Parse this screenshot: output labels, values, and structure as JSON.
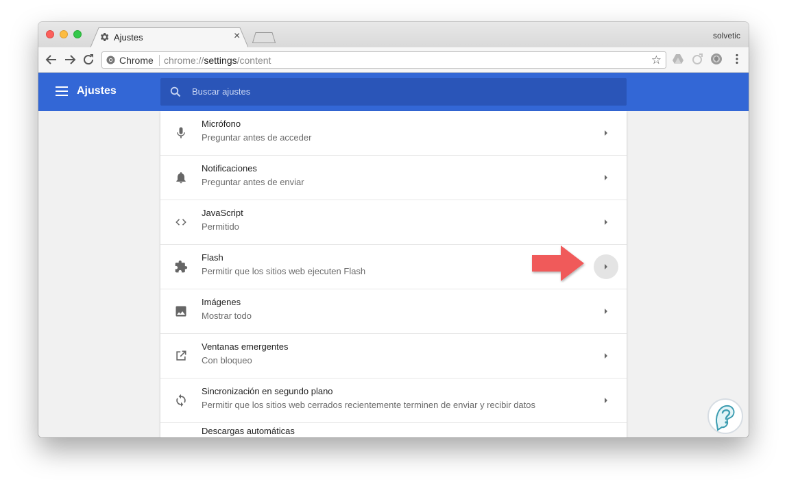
{
  "browser": {
    "tab_title": "Ajustes",
    "tab_close_glyph": "×",
    "profile_name": "solvetic",
    "omnibox": {
      "scheme_label": "Chrome",
      "url_prefix": "chrome://",
      "url_host": "settings",
      "url_path": "/content"
    }
  },
  "settings": {
    "title": "Ajustes",
    "search_placeholder": "Buscar ajustes"
  },
  "rows": [
    {
      "icon": "microphone-icon",
      "title": "Micrófono",
      "subtitle": "Preguntar antes de acceder"
    },
    {
      "icon": "bell-icon",
      "title": "Notificaciones",
      "subtitle": "Preguntar antes de enviar"
    },
    {
      "icon": "code-icon",
      "title": "JavaScript",
      "subtitle": "Permitido"
    },
    {
      "icon": "puzzle-icon",
      "title": "Flash",
      "subtitle": "Permitir que los sitios web ejecuten Flash",
      "highlighted": true
    },
    {
      "icon": "image-icon",
      "title": "Imágenes",
      "subtitle": "Mostrar todo"
    },
    {
      "icon": "open-in-new-icon",
      "title": "Ventanas emergentes",
      "subtitle": "Con bloqueo"
    },
    {
      "icon": "sync-icon",
      "title": "Sincronización en segundo plano",
      "subtitle": "Permitir que los sitios web cerrados recientemente terminen de enviar y recibir datos"
    },
    {
      "icon": "download-icon",
      "title": "Descargas automáticas",
      "subtitle": ""
    }
  ],
  "colors": {
    "header_blue": "#3367d6",
    "search_blue": "#2a55b8",
    "callout_red": "#f05a5a"
  }
}
